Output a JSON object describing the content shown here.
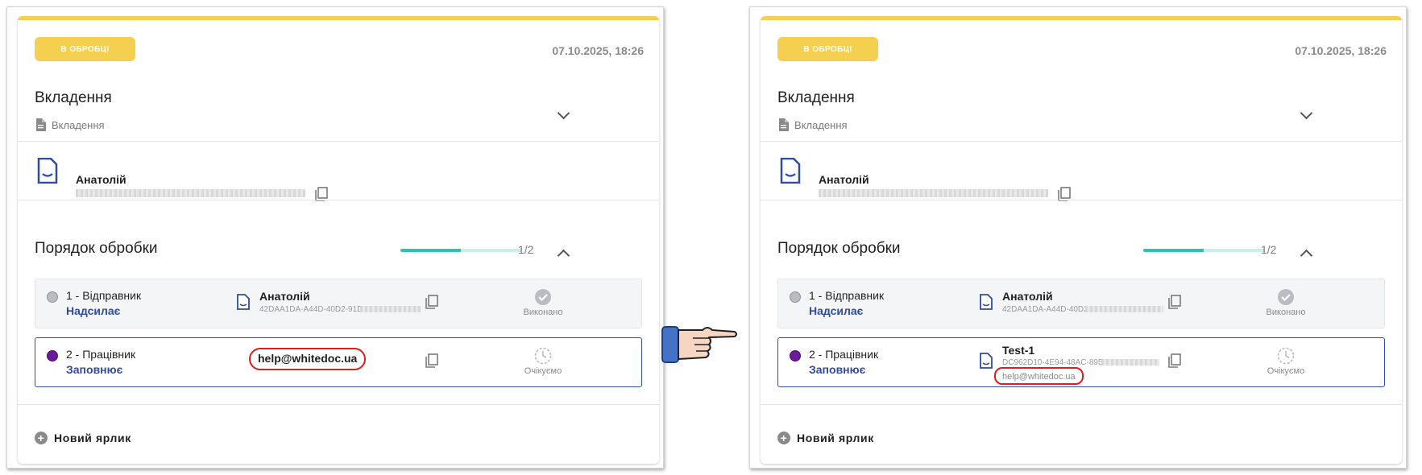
{
  "panels": [
    {
      "status_badge": "В ОБРОБЦІ",
      "date": "07.10.2025, 18:26",
      "attachments_title": "Вкладення",
      "attachments_item": "Вкладення",
      "sender_name": "Анатолій",
      "order_title": "Порядок обробки",
      "progress_text": "1/2",
      "progress_fraction": 0.5,
      "steps": [
        {
          "title": "1 - Відправник",
          "role": "Надсилає",
          "signer": "Анатолій",
          "id": "42DAA1DA-A44D-40D2-91D0",
          "status": "Виконано"
        },
        {
          "title": "2 - Працівник",
          "role": "Заповнює",
          "email": "help@whitedoc.ua",
          "status": "Очікуємо"
        }
      ],
      "new_label": "Новий ярлик"
    },
    {
      "status_badge": "В ОБРОБЦІ",
      "date": "07.10.2025, 18:26",
      "attachments_title": "Вкладення",
      "attachments_item": "Вкладення",
      "sender_name": "Анатолій",
      "order_title": "Порядок обробки",
      "progress_text": "1/2",
      "progress_fraction": 0.5,
      "steps": [
        {
          "title": "1 - Відправник",
          "role": "Надсилає",
          "signer": "Анатолій",
          "id": "42DAA1DA-A44D-40D2",
          "status": "Виконано"
        },
        {
          "title": "2 - Працівник",
          "role": "Заповнює",
          "signer": "Test-1",
          "id": "DC962D10-4E94-48AC-8958-",
          "email": "help@whitedoc.ua",
          "status": "Очікуємо"
        }
      ],
      "new_label": "Новий ярлик"
    }
  ],
  "colors": {
    "accent_yellow": "#f5cf4f",
    "brand_blue": "#2f4ba3",
    "progress_teal": "#2fc2b1",
    "highlight_red": "#e01b1b"
  },
  "icons": {
    "document": "document-icon",
    "copy": "copy-icon",
    "check": "check-circle-icon",
    "clock": "clock-icon",
    "plus": "plus-circle-icon",
    "pointer": "pointing-hand-icon"
  }
}
